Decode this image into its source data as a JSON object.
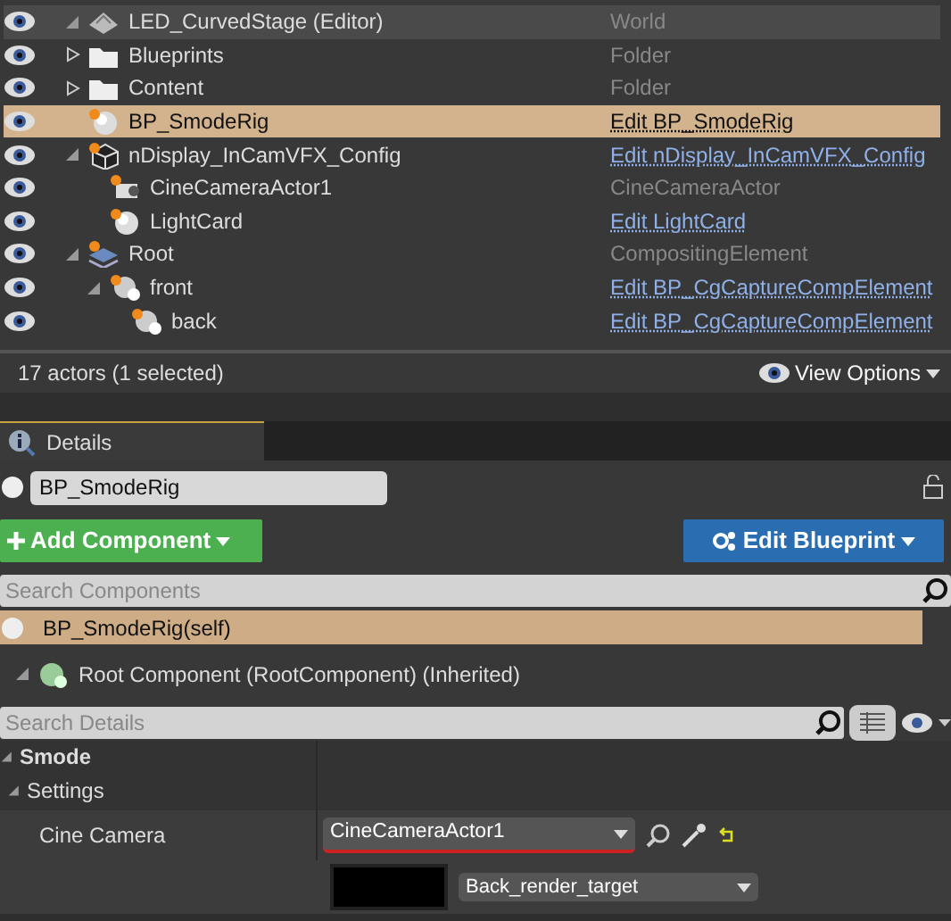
{
  "outliner": {
    "rows": [
      {
        "name": "LED_CurvedStage (Editor)",
        "type": "World",
        "kind": "world",
        "selected": false,
        "expanded": true,
        "children": [
          {
            "name": "Blueprints",
            "type": "Folder",
            "kind": "folder",
            "selected": false,
            "expanded": false
          },
          {
            "name": "Content",
            "type": "Folder",
            "kind": "folder",
            "selected": false,
            "expanded": false
          },
          {
            "name": "BP_SmodeRig",
            "type": "Edit BP_SmodeRig",
            "kind": "blueprint",
            "selected": true
          },
          {
            "name": "nDisplay_InCamVFX_Config",
            "type": "Edit nDisplay_InCamVFX_Config",
            "kind": "display",
            "selected": false,
            "expanded": true,
            "children": [
              {
                "name": "CineCameraActor1",
                "type": "CineCameraActor",
                "kind": "camera",
                "selected": false
              },
              {
                "name": "LightCard",
                "type": "Edit LightCard",
                "kind": "blueprint",
                "selected": false
              }
            ]
          },
          {
            "name": "Root",
            "type": "CompositingElement",
            "kind": "compositing",
            "selected": false,
            "expanded": true,
            "children": [
              {
                "name": "front",
                "type": "Edit BP_CgCaptureCompElement",
                "kind": "capture",
                "selected": false,
                "expanded": true,
                "children": [
                  {
                    "name": "back",
                    "type": "Edit BP_CgCaptureCompElement",
                    "kind": "capture",
                    "selected": false
                  }
                ]
              }
            ]
          }
        ]
      }
    ],
    "status": "17 actors (1 selected)",
    "view_options": "View Options"
  },
  "details": {
    "tab": "Details",
    "name_value": "BP_SmodeRig",
    "add_button": "Add Component",
    "edit_button": "Edit Blueprint",
    "search_components": {
      "placeholder": "Search Components"
    },
    "components": [
      {
        "name": "BP_SmodeRig(self)",
        "selected": true
      },
      {
        "name": "Root Component (RootComponent) (Inherited)",
        "selected": false,
        "expanded": true
      }
    ],
    "search_details": {
      "placeholder": "Search Details"
    },
    "category": "Smode",
    "subcategory": "Settings",
    "property": {
      "label": "Cine Camera",
      "value": "CineCameraActor1",
      "render_target": "Back_render_target"
    }
  }
}
